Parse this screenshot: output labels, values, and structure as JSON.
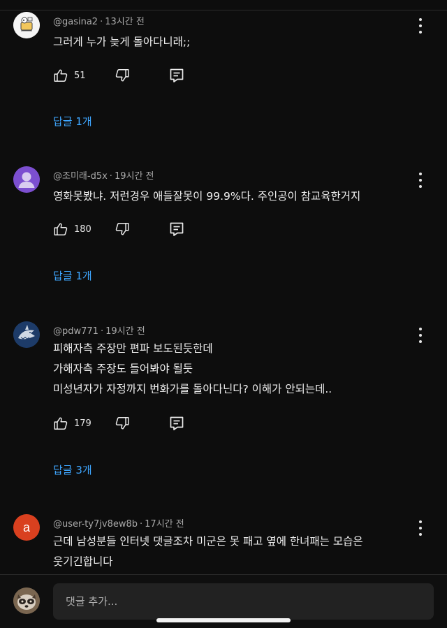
{
  "comments": [
    {
      "author": "@gasina2",
      "time": "13시간 전",
      "lines": [
        "그러게 누가 늦게 돌아다니래;;"
      ],
      "likes": "51",
      "replies_label": "답글 1개",
      "avatar_icon": "cartoon-avatar-icon"
    },
    {
      "author": "@조미래-d5x",
      "time": "19시간 전",
      "lines": [
        "영화못봤냐. 저런경우 애들잘못이 99.9%다.   주인공이 참교육한거지"
      ],
      "likes": "180",
      "replies_label": "답글 1개",
      "avatar_icon": "default-person-icon",
      "avatar_color": "#7c4fd0"
    },
    {
      "author": "@pdw771",
      "time": "19시간 전",
      "lines": [
        "피해자측 주장만 편파 보도된듯한데",
        "가해자측 주장도 들어봐야 될듯",
        "미성년자가 자정까지 번화가를 돌아다닌다?  이해가 안되는데.."
      ],
      "likes": "179",
      "replies_label": "답글 3개",
      "avatar_icon": "shark-avatar-icon"
    },
    {
      "author": "@user-ty7jv8ew8b",
      "time": "17시간 전",
      "lines": [
        "근데 남성분들 인터넷 댓글조차 미군은 못 패고 옆에 한녀패는 모습은",
        "웃기긴합니다"
      ],
      "avatar_letter": "a",
      "avatar_color": "#d9401f"
    }
  ],
  "add_comment": {
    "placeholder": "댓글 추가..."
  },
  "separator": "·"
}
